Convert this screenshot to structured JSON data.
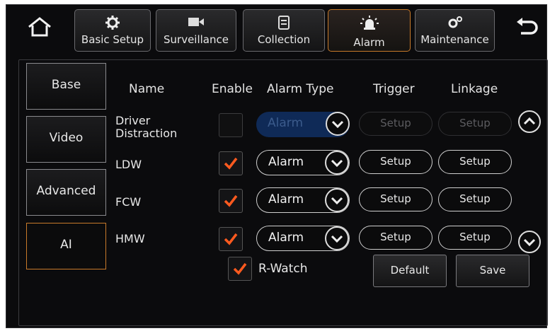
{
  "nav": {
    "tabs": [
      {
        "label": "Basic Setup",
        "icon": "gear-icon"
      },
      {
        "label": "Surveillance",
        "icon": "camera-icon"
      },
      {
        "label": "Collection",
        "icon": "document-icon"
      },
      {
        "label": "Alarm",
        "icon": "alarm-light-icon",
        "active": true
      },
      {
        "label": "Maintenance",
        "icon": "gears-icon"
      }
    ]
  },
  "menu": [
    {
      "label": "Base"
    },
    {
      "label": "Video"
    },
    {
      "label": "Advanced"
    },
    {
      "label": "AI",
      "active": true
    }
  ],
  "table": {
    "headers": {
      "name": "Name",
      "enable": "Enable",
      "alarm_type": "Alarm Type",
      "trigger": "Trigger",
      "linkage": "Linkage"
    },
    "rows": [
      {
        "name_line1": "Driver",
        "name_line2": "Distraction",
        "enabled": false,
        "alarm_type": "Alarm",
        "trigger": "Setup",
        "linkage": "Setup",
        "disabled": true
      },
      {
        "name": "LDW",
        "enabled": true,
        "alarm_type": "Alarm",
        "trigger": "Setup",
        "linkage": "Setup"
      },
      {
        "name": "FCW",
        "enabled": true,
        "alarm_type": "Alarm",
        "trigger": "Setup",
        "linkage": "Setup"
      },
      {
        "name": "HMW",
        "enabled": true,
        "alarm_type": "Alarm",
        "trigger": "Setup",
        "linkage": "Setup"
      }
    ]
  },
  "rwatch": {
    "label": "R-Watch",
    "checked": true
  },
  "actions": {
    "default": "Default",
    "save": "Save"
  },
  "colors": {
    "accent": "#c87a2a",
    "check": "#ff5a1f",
    "disabled_select": "#0f2a57"
  }
}
